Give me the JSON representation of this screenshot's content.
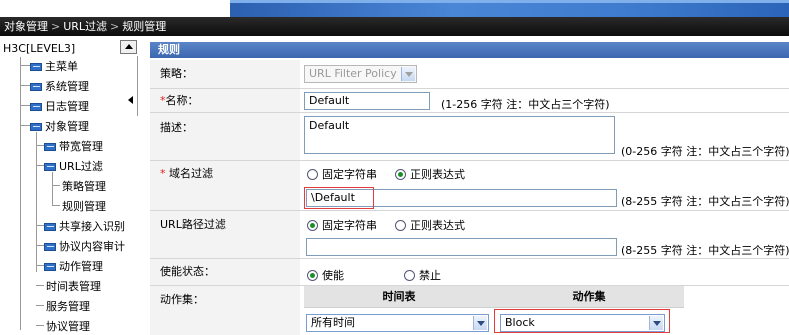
{
  "breadcrumb": [
    "对象管理",
    "URL过滤",
    "规则管理"
  ],
  "tree": {
    "root": "H3C[LEVEL3]",
    "nodes": {
      "main_menu": "主菜单",
      "system": "系统管理",
      "log": "日志管理",
      "objects": "对象管理",
      "bandwidth": "带宽管理",
      "url_filter": "URL过滤",
      "policy": "策略管理",
      "rule": "规则管理",
      "shared_access": "共享接入识别",
      "protocol_audit": "协议内容审计",
      "action": "动作管理",
      "schedule": "时间表管理",
      "service": "服务管理",
      "protocol": "协议管理"
    }
  },
  "form": {
    "header": "规则",
    "policy": {
      "label": "策略：",
      "value": "URL Filter Policy"
    },
    "name": {
      "required": "*",
      "label": "名称：",
      "value": "Default",
      "hint": "(1-256 字符 注：中文占三个字符)"
    },
    "description": {
      "label": "描述：",
      "value": "Default",
      "hint": "(0-256 字符 注：中文占三个字符)"
    },
    "domain_filter": {
      "required": "*",
      "label": "域名过滤",
      "opt_fixed": "固定字符串",
      "opt_regex": "正则表达式",
      "selected": "regex",
      "value": "\\Default",
      "hint": "(8-255 字符 注：中文占三个字符)"
    },
    "url_path_filter": {
      "label": "URL路径过滤",
      "opt_fixed": "固定字符串",
      "opt_regex": "正则表达式",
      "selected": "fixed",
      "value": "",
      "hint": "(8-255 字符 注：中文占三个字符)"
    },
    "enable": {
      "label": "使能状态：",
      "opt_on": "使能",
      "opt_off": "禁止",
      "selected": "on"
    },
    "action_set": {
      "label": "动作集：",
      "col_schedule": "时间表",
      "col_action": "动作集",
      "schedule_value": "所有时间",
      "action_value": "Block"
    }
  },
  "colors": {
    "header_blue": "#3c67b0",
    "highlight_red": "#e23c3c",
    "radio_green": "#1b8f27"
  }
}
